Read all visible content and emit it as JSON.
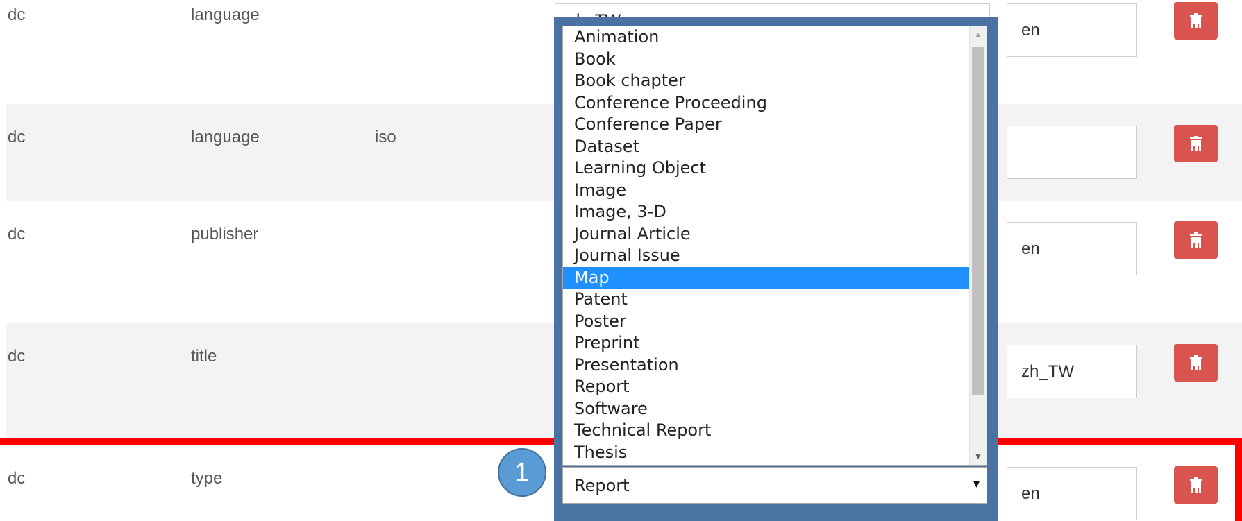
{
  "rows": [
    {
      "schema": "dc",
      "element": "language",
      "qualifier": "",
      "value": "zh_TW",
      "lang": "en"
    },
    {
      "schema": "dc",
      "element": "language",
      "qualifier": "iso",
      "value": "",
      "lang": ""
    },
    {
      "schema": "dc",
      "element": "publisher",
      "qualifier": "",
      "value": "",
      "lang": "en"
    },
    {
      "schema": "dc",
      "element": "title",
      "qualifier": "",
      "value": "",
      "lang": "zh_TW"
    },
    {
      "schema": "dc",
      "element": "type",
      "qualifier": "",
      "value": "Report",
      "lang": "en"
    }
  ],
  "dropdown": {
    "options": [
      "Animation",
      "Book",
      "Book chapter",
      "Conference Proceeding",
      "Conference Paper",
      "Dataset",
      "Learning Object",
      "Image",
      "Image, 3-D",
      "Journal Article",
      "Journal Issue",
      "Map",
      "Patent",
      "Poster",
      "Preprint",
      "Presentation",
      "Report",
      "Software",
      "Technical Report",
      "Thesis"
    ],
    "highlighted": "Map",
    "selected_value": "Report",
    "arrow": "▾"
  },
  "badge": "1",
  "icons": {
    "delete": "trash-icon",
    "scroll_up": "scroll-up-arrow-icon",
    "scroll_down": "scroll-down-arrow-icon"
  },
  "colors": {
    "delete_button": "#d9534f",
    "highlight_option": "#1e90ff",
    "frame_blue": "#4a72a3",
    "frame_red": "#ff0000",
    "badge": "#5b9bd5"
  }
}
